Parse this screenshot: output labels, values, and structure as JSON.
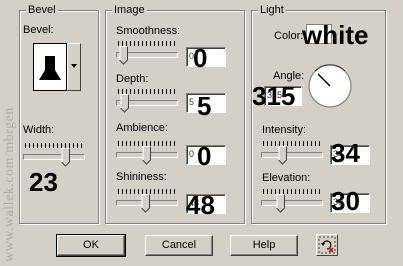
{
  "watermark": "www.wallek.com/mbrgen",
  "bevel": {
    "group_title": "Bevel",
    "bevel_label": "Bevel:",
    "width_label": "Width:",
    "width_value": "23",
    "width_slider_fraction": 0.72
  },
  "image": {
    "group_title": "Image",
    "smoothness_label": "Smoothness:",
    "smoothness_value": "0",
    "smoothness_small": "0",
    "smoothness_slider_fraction": 0.08,
    "depth_label": "Depth:",
    "depth_value": "5",
    "depth_small": "5",
    "depth_slider_fraction": 0.1,
    "ambience_label": "Ambience:",
    "ambience_value": "0",
    "ambience_small": "0",
    "ambience_slider_fraction": 0.5,
    "shininess_label": "Shininess:",
    "shininess_value": "48",
    "shininess_small": "48",
    "shininess_slider_fraction": 0.48
  },
  "light": {
    "group_title": "Light",
    "color_label": "Color:",
    "color_value": "white",
    "color_hex": "#ffffff",
    "angle_label": "Angle:",
    "angle_value": "315",
    "angle_small": "315",
    "intensity_label": "Intensity:",
    "intensity_value": "34",
    "intensity_small": "34",
    "intensity_slider_fraction": 0.34,
    "elevation_label": "Elevation:",
    "elevation_value": "30",
    "elevation_small": "30",
    "elevation_slider_fraction": 0.3
  },
  "buttons": {
    "ok_label": "OK",
    "cancel_label": "Cancel",
    "help_label": "Help"
  },
  "icons": {
    "bevel_preview": "bevel-shape-icon",
    "dropdown": "chevron-down-icon",
    "reset": "reset-icon"
  }
}
